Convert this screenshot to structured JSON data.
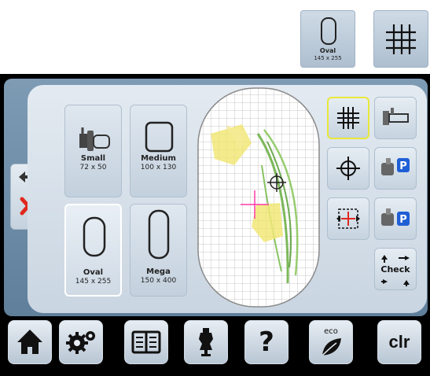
{
  "legend": {
    "oval_label": "Oval",
    "oval_size": "145 x 255"
  },
  "hoops": [
    {
      "name": "Small",
      "size": "72 x 50"
    },
    {
      "name": "Medium",
      "size": "100 x 130"
    },
    {
      "name": "Oval",
      "size": "145 x 255",
      "selected": true
    },
    {
      "name": "Mega",
      "size": "150 x 400"
    }
  ],
  "tools": {
    "check_label": "Check",
    "p_badge": "P"
  },
  "footer": {
    "help_label": "?",
    "eco_label": "eco",
    "clr_label": "clr"
  },
  "colors": {
    "panel": "#6f8ca6",
    "selected_tool_border": "#e9e83a",
    "badge_blue": "#1f5fd6",
    "cancel_red": "#e0281e"
  }
}
